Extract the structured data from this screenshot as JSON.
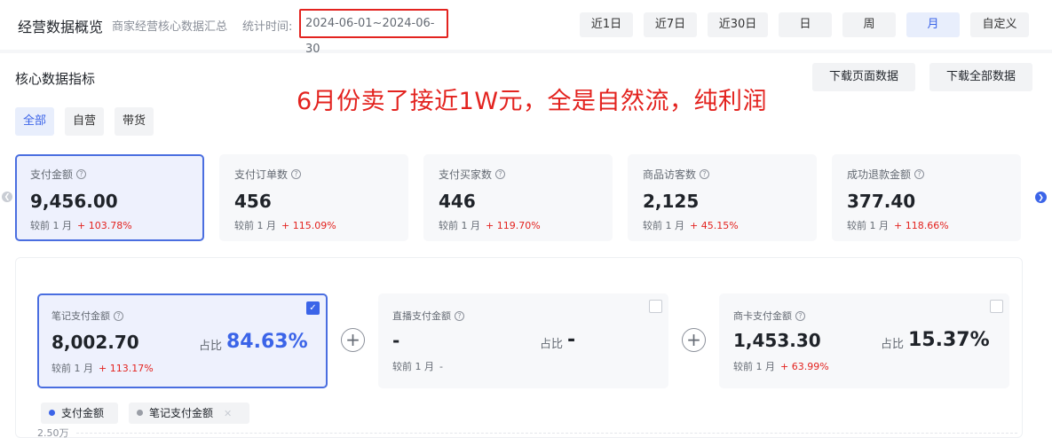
{
  "header": {
    "title": "经营数据概览",
    "subtitle": "商家经营核心数据汇总",
    "stat_time_label": "统计时间:",
    "date_range": "2024-06-01~2024-06-30",
    "range_buttons": [
      "近1日",
      "近7日",
      "近30日",
      "日",
      "周",
      "月",
      "自定义"
    ],
    "active_range": "月"
  },
  "section": {
    "title": "核心数据指标",
    "download_page": "下载页面数据",
    "download_all": "下载全部数据"
  },
  "annotation": "6月份卖了接近1W元，全是自然流，纯利润",
  "filter_tabs": [
    "全部",
    "自营",
    "带货"
  ],
  "active_filter": "全部",
  "metrics": [
    {
      "label": "支付金额",
      "value": "9,456.00",
      "compare": "较前 1 月",
      "change": "+ 103.78%"
    },
    {
      "label": "支付订单数",
      "value": "456",
      "compare": "较前 1 月",
      "change": "+ 115.09%"
    },
    {
      "label": "支付买家数",
      "value": "446",
      "compare": "较前 1 月",
      "change": "+ 119.70%"
    },
    {
      "label": "商品访客数",
      "value": "2,125",
      "compare": "较前 1 月",
      "change": "+ 45.15%"
    },
    {
      "label": "成功退款金额",
      "value": "377.40",
      "compare": "较前 1 月",
      "change": "+ 118.66%"
    }
  ],
  "breakdown": [
    {
      "label": "笔记支付金额",
      "value": "8,002.70",
      "share_label": "占比",
      "share": "84.63%",
      "compare": "较前 1 月",
      "change": "+ 113.17%",
      "checked": true
    },
    {
      "label": "直播支付金额",
      "value": "-",
      "share_label": "占比",
      "share": "-",
      "compare": "较前 1 月",
      "change": "-",
      "checked": false
    },
    {
      "label": "商卡支付金额",
      "value": "1,453.30",
      "share_label": "占比",
      "share": "15.37%",
      "compare": "较前 1 月",
      "change": "+ 63.99%",
      "checked": false
    }
  ],
  "legend": [
    {
      "label": "支付金额",
      "color": "#3b64e8"
    },
    {
      "label": "笔记支付金额",
      "color": "#9a9ea6"
    }
  ],
  "chart": {
    "top_tick": "2.50万"
  },
  "colors": {
    "accent": "#3b64e8",
    "positive_change": "#e3231f",
    "highlight_border": "#e3231f"
  }
}
